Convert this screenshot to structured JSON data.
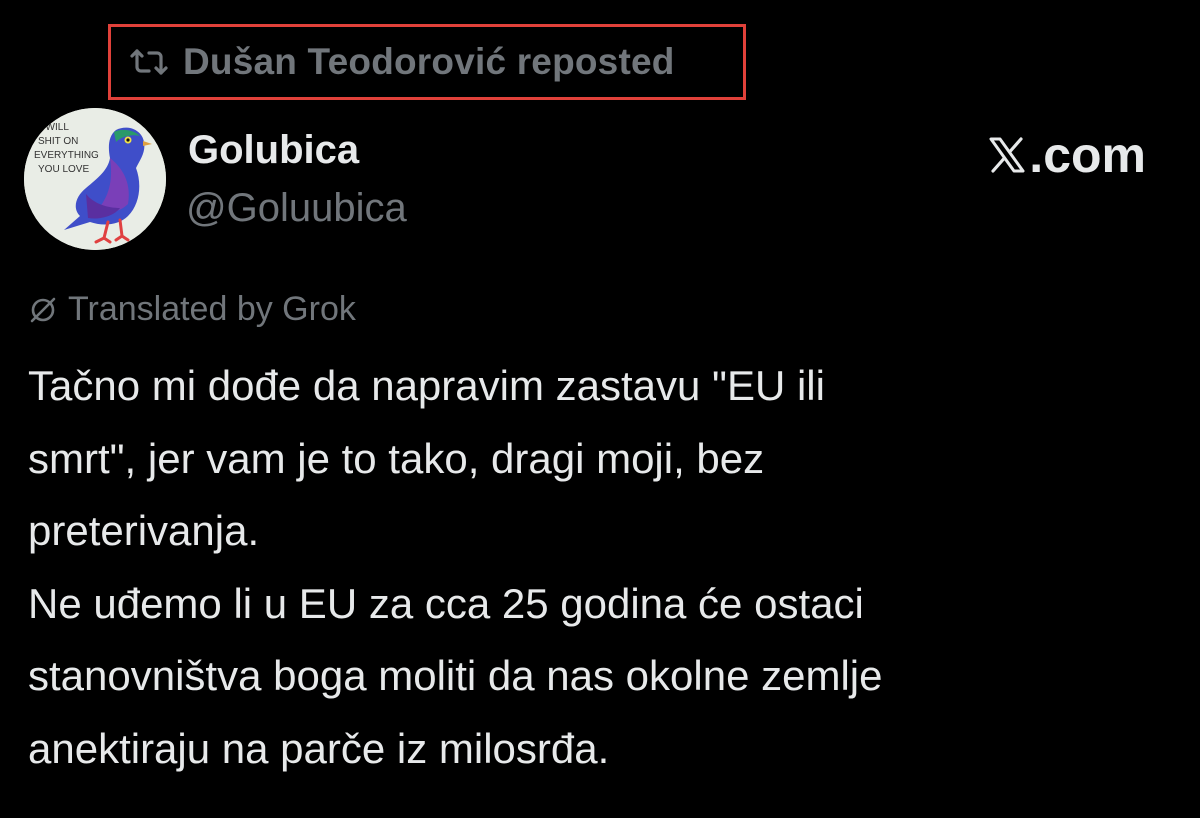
{
  "repost": {
    "icon": "repost-icon",
    "label": "Dušan Teodorović reposted",
    "highlight_color": "#e0413a"
  },
  "author": {
    "display_name": "Golubica",
    "handle": "@Goluubica",
    "avatar_text": [
      "I WILL",
      "SHIT ON",
      "EVERYTHING",
      "YOU LOVE"
    ]
  },
  "brand": {
    "text": ".com",
    "icon": "x-logo-icon"
  },
  "translation": {
    "icon": "grok-icon",
    "label": "Translated by Grok"
  },
  "post": {
    "lines": [
      "Tačno mi dođe da napravim zastavu \"EU ili",
      "smrt\", jer vam je to tako, dragi moji, bez",
      "preterivanja.",
      "Ne uđemo li u EU za cca 25 godina će ostaci",
      "stanovništva boga moliti da nas okolne zemlje",
      "anektiraju na parče iz milosrđa."
    ]
  },
  "colors": {
    "background": "#000000",
    "primary_text": "#e7e9ea",
    "secondary_text": "#71767b"
  }
}
